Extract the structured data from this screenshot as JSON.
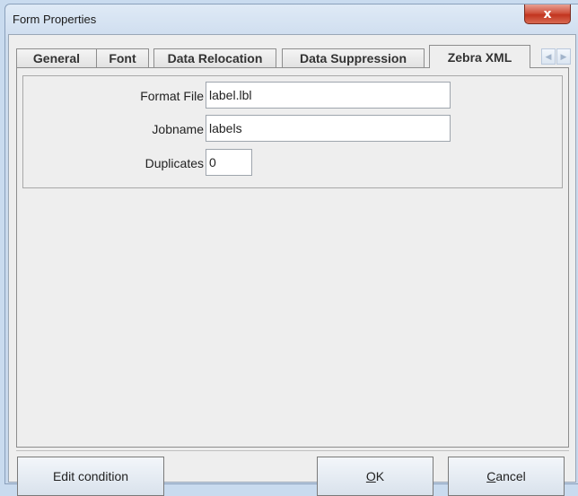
{
  "window": {
    "title": "Form Properties",
    "close_glyph": "x"
  },
  "tabs": [
    {
      "label": "General"
    },
    {
      "label": "Font"
    },
    {
      "label": "Data Relocation"
    },
    {
      "label": "Data Suppression"
    },
    {
      "label": "Zebra XML",
      "selected": true
    }
  ],
  "tab_scroll": {
    "left_icon": "scroll-left-icon",
    "right_icon": "scroll-right-icon"
  },
  "fields": {
    "format_file": {
      "label": "Format File",
      "value": "label.lbl"
    },
    "jobname": {
      "label": "Jobname",
      "value": "labels"
    },
    "duplicates": {
      "label": "Duplicates",
      "value": "0"
    }
  },
  "buttons": {
    "edit_condition": "Edit condition",
    "ok_mnemonic": "O",
    "ok_rest": "K",
    "cancel_mnemonic": "C",
    "cancel_rest": "ancel"
  }
}
